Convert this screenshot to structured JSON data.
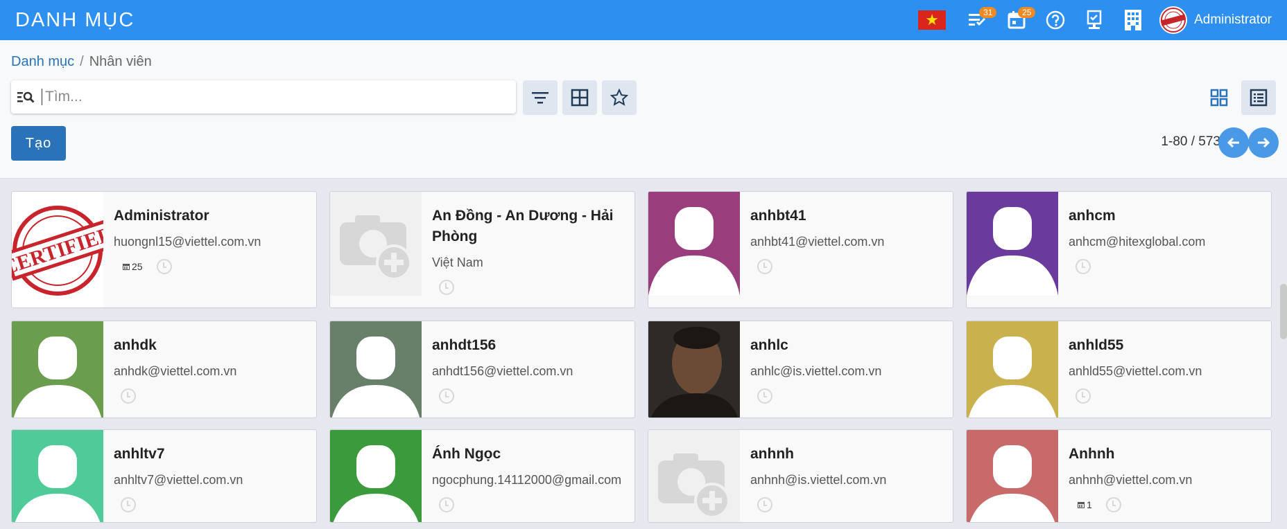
{
  "app": {
    "title": "DANH MỤC"
  },
  "navbar": {
    "activities_count": "31",
    "calendar_count": "25",
    "user_name": "Administrator"
  },
  "breadcrumb": {
    "parent": "Danh mục",
    "current": "Nhân viên"
  },
  "search": {
    "placeholder": "Tìm..."
  },
  "toolbar": {
    "create_label": "Tạo"
  },
  "pager": {
    "text": "1-80 / 573"
  },
  "colors": {
    "navbar": "#2d8ff0",
    "primary": "#2a73b8",
    "badge": "#f08a24"
  },
  "cards": [
    {
      "name": "Administrator",
      "sub": "huongnl15@viettel.com.vn",
      "count": "25",
      "avatar_type": "certified",
      "avatar_color": "#ffffff"
    },
    {
      "name": "An Đồng - An Dương - Hải Phòng",
      "sub": "Việt Nam",
      "count": "",
      "avatar_type": "camera",
      "avatar_color": "#f0f0f0"
    },
    {
      "name": "anhbt41",
      "sub": "anhbt41@viettel.com.vn",
      "count": "",
      "avatar_type": "silhouette",
      "avatar_color": "#993d7c"
    },
    {
      "name": "anhcm",
      "sub": "anhcm@hitexglobal.com",
      "count": "",
      "avatar_type": "silhouette",
      "avatar_color": "#6a3a9c"
    },
    {
      "name": "anhdk",
      "sub": "anhdk@viettel.com.vn",
      "count": "",
      "avatar_type": "silhouette",
      "avatar_color": "#6a9d4d"
    },
    {
      "name": "anhdt156",
      "sub": "anhdt156@viettel.com.vn",
      "count": "",
      "avatar_type": "silhouette",
      "avatar_color": "#687f6a"
    },
    {
      "name": "anhlc",
      "sub": "anhlc@is.viettel.com.vn",
      "count": "",
      "avatar_type": "photo",
      "avatar_color": "#3b3530"
    },
    {
      "name": "anhld55",
      "sub": "anhld55@viettel.com.vn",
      "count": "",
      "avatar_type": "silhouette",
      "avatar_color": "#c9b14e"
    },
    {
      "name": "anhltv7",
      "sub": "anhltv7@viettel.com.vn",
      "count": "",
      "avatar_type": "silhouette",
      "avatar_color": "#4fcb99"
    },
    {
      "name": "Ánh Ngọc",
      "sub": "ngocphung.14112000@gmail.com",
      "count": "",
      "avatar_type": "silhouette",
      "avatar_color": "#3a9a3c"
    },
    {
      "name": "anhnh",
      "sub": "anhnh@is.viettel.com.vn",
      "count": "",
      "avatar_type": "camera",
      "avatar_color": "#f0f0f0"
    },
    {
      "name": "Anhnh",
      "sub": "anhnh@viettel.com.vn",
      "count": "1",
      "avatar_type": "silhouette",
      "avatar_color": "#c96a6a"
    }
  ]
}
